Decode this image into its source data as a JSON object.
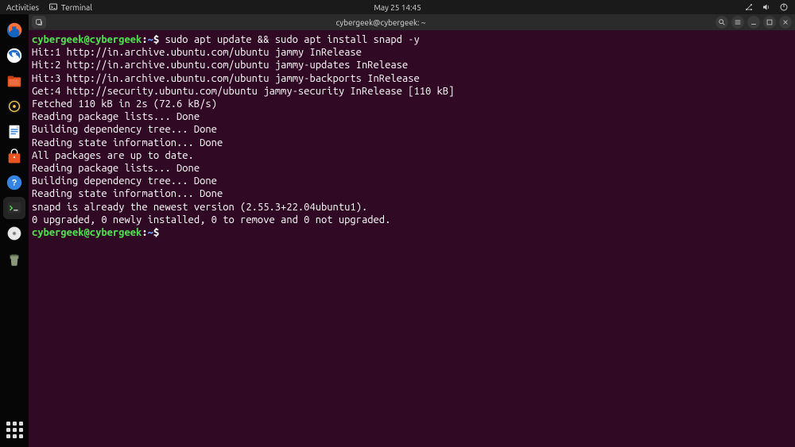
{
  "panel": {
    "activities": "Activities",
    "app_label": "Terminal",
    "clock": "May 25  14:45",
    "status_icons": [
      "network-icon",
      "volume-icon",
      "power-icon"
    ]
  },
  "dock": {
    "items": [
      {
        "name": "firefox-icon",
        "color": "#ff7139"
      },
      {
        "name": "thunderbird-icon",
        "color": "#1f6fd0"
      },
      {
        "name": "files-icon",
        "color": "#e95420"
      },
      {
        "name": "rhythmbox-icon",
        "color": "#f7c948"
      },
      {
        "name": "libreoffice-writer-icon",
        "color": "#2b7de9"
      },
      {
        "name": "software-center-icon",
        "color": "#e95420"
      },
      {
        "name": "help-icon",
        "color": "#3584e4"
      },
      {
        "name": "terminal-icon",
        "color": "#333333"
      },
      {
        "name": "disc-icon",
        "color": "#cccccc"
      },
      {
        "name": "trash-icon",
        "color": "#8a8a8a"
      }
    ],
    "active_index": 7
  },
  "window": {
    "title": "cybergeek@cybergeek: ~"
  },
  "terminal": {
    "prompt": {
      "user_host": "cybergeek@cybergeek",
      "colon": ":",
      "path": "~",
      "symbol": "$"
    },
    "command": "sudo apt update && sudo apt install snapd -y",
    "output_lines": [
      "Hit:1 http://in.archive.ubuntu.com/ubuntu jammy InRelease",
      "Hit:2 http://in.archive.ubuntu.com/ubuntu jammy-updates InRelease",
      "Hit:3 http://in.archive.ubuntu.com/ubuntu jammy-backports InRelease",
      "Get:4 http://security.ubuntu.com/ubuntu jammy-security InRelease [110 kB]",
      "Fetched 110 kB in 2s (72.6 kB/s)",
      "Reading package lists... Done",
      "Building dependency tree... Done",
      "Reading state information... Done",
      "All packages are up to date.",
      "Reading package lists... Done",
      "Building dependency tree... Done",
      "Reading state information... Done",
      "snapd is already the newest version (2.55.3+22.04ubuntu1).",
      "0 upgraded, 0 newly installed, 0 to remove and 0 not upgraded."
    ]
  }
}
